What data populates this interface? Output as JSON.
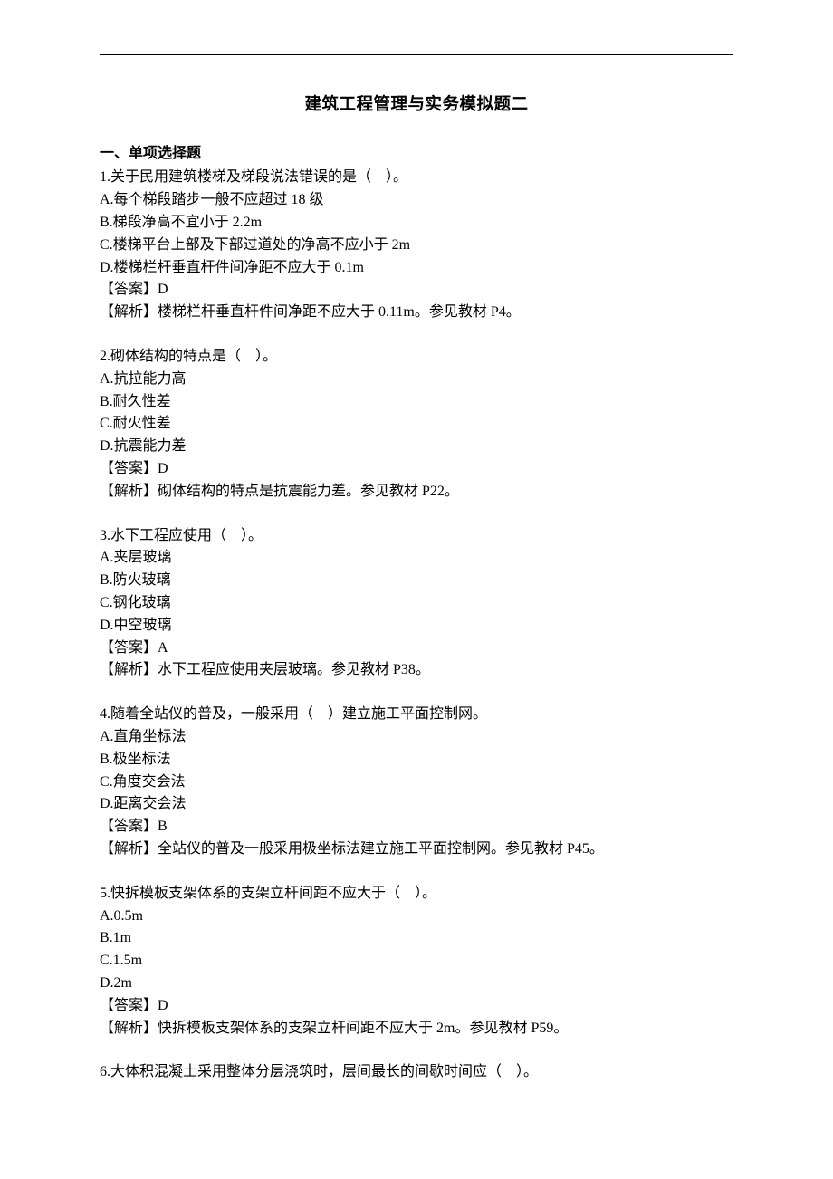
{
  "title": "建筑工程管理与实务模拟题二",
  "section_heading": "一、单项选择题",
  "questions": [
    {
      "stem": "1.关于民用建筑楼梯及梯段说法错误的是（　）。",
      "options": [
        "A.每个梯段踏步一般不应超过 18 级",
        "B.梯段净高不宜小于 2.2m",
        "C.楼梯平台上部及下部过道处的净高不应小于 2m",
        "D.楼梯栏杆垂直杆件间净距不应大于 0.1m"
      ],
      "answer": "【答案】D",
      "explain": "【解析】楼梯栏杆垂直杆件间净距不应大于 0.11m。参见教材 P4。"
    },
    {
      "stem": "2.砌体结构的特点是（　）。",
      "options": [
        "A.抗拉能力高",
        "B.耐久性差",
        "C.耐火性差",
        "D.抗震能力差"
      ],
      "answer": "【答案】D",
      "explain": "【解析】砌体结构的特点是抗震能力差。参见教材 P22。"
    },
    {
      "stem": "3.水下工程应使用（　）。",
      "options": [
        "A.夹层玻璃",
        "B.防火玻璃",
        "C.钢化玻璃",
        "D.中空玻璃"
      ],
      "answer": "【答案】A",
      "explain": "【解析】水下工程应使用夹层玻璃。参见教材 P38。"
    },
    {
      "stem": "4.随着全站仪的普及，一般采用（　）建立施工平面控制网。",
      "options": [
        "A.直角坐标法",
        "B.极坐标法",
        "C.角度交会法",
        "D.距离交会法"
      ],
      "answer": "【答案】B",
      "explain": "【解析】全站仪的普及一般采用极坐标法建立施工平面控制网。参见教材 P45。"
    },
    {
      "stem": "5.快拆模板支架体系的支架立杆间距不应大于（　）。",
      "options": [
        "A.0.5m",
        "B.1m",
        "C.1.5m",
        "D.2m"
      ],
      "answer": "【答案】D",
      "explain": "【解析】快拆模板支架体系的支架立杆间距不应大于 2m。参见教材 P59。"
    },
    {
      "stem": "6.大体积混凝土采用整体分层浇筑时，层间最长的间歇时间应（　）。",
      "options": [],
      "answer": "",
      "explain": ""
    }
  ]
}
